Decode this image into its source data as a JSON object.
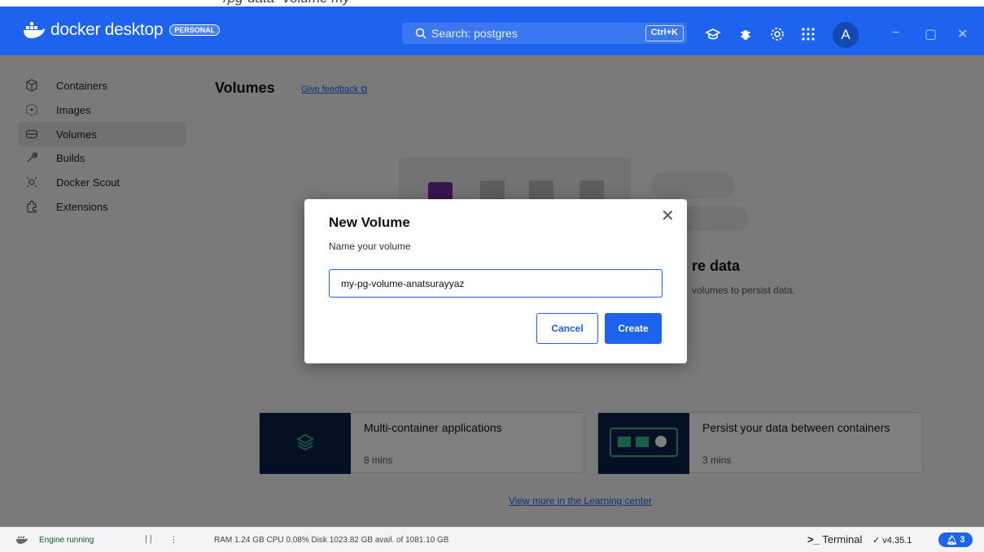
{
  "top_strip_text": "/pg-data -volume my",
  "header": {
    "brand": "docker desktop",
    "badge": "PERSONAL",
    "search_text": "Search: postgres",
    "shortcut": "Ctrl+K",
    "avatar_letter": "A"
  },
  "sidebar": {
    "items": [
      {
        "label": "Containers"
      },
      {
        "label": "Images"
      },
      {
        "label": "Volumes"
      },
      {
        "label": "Builds"
      },
      {
        "label": "Docker Scout"
      },
      {
        "label": "Extensions"
      }
    ]
  },
  "main": {
    "title": "Volumes",
    "feedback": "Give feedback",
    "empty_title": "re data",
    "empty_sub": "volumes to persist data.",
    "cards": [
      {
        "title": "Multi-container applications",
        "duration": "8 mins"
      },
      {
        "title": "Persist your data between containers",
        "duration": "3 mins"
      }
    ],
    "learn_link": "View more in the Learning center"
  },
  "modal": {
    "title": "New Volume",
    "label": "Name your volume",
    "input_value": "my-pg-volume-anatsurayyaz",
    "cancel": "Cancel",
    "create": "Create"
  },
  "footer": {
    "engine": "Engine running",
    "stats": "RAM 1.24 GB  CPU 0.08%   Disk 1023.82 GB avail. of 1081.10 GB",
    "terminal": "Terminal",
    "version": "v4.35.1",
    "notifications": "3"
  },
  "colors": {
    "accent": "#1d63ed",
    "header_bg": "#1d63ed",
    "card_thumb": "#0b214a"
  }
}
